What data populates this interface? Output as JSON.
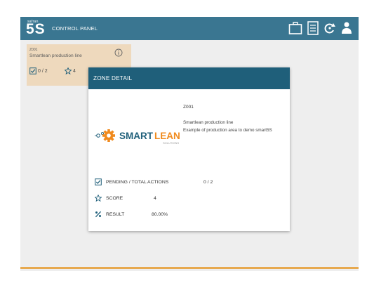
{
  "header": {
    "logo_small": "safran",
    "logo_big": "5S",
    "panel_title": "CONTROL PANEL",
    "icons": [
      "briefcase-icon",
      "checklist-icon",
      "refresh-icon",
      "user-icon"
    ]
  },
  "zone_card": {
    "code": "Z001",
    "name": "Smartlean production line",
    "actions": "0 / 2",
    "score": "4"
  },
  "modal": {
    "title": "ZONE DETAIL",
    "brand_smart": "SMART",
    "brand_lean": "LEAN",
    "brand_solutions": "SOLUTIONS",
    "code": "Z001",
    "name": "Smartlean production line",
    "description": "Example of production area to demo smart5S",
    "stats": {
      "pending_label": "PENDING / TOTAL ACTIONS",
      "pending_value": "0 / 2",
      "score_label": "SCORE",
      "score_value": "4",
      "result_label": "RESULT",
      "result_value": "80.00%"
    }
  },
  "colors": {
    "header": "#3a7691",
    "modal_header": "#1f5f7a",
    "card": "#eed9bd",
    "accent_orange": "#f08a1d",
    "bottom_line": "#e7a94f"
  }
}
